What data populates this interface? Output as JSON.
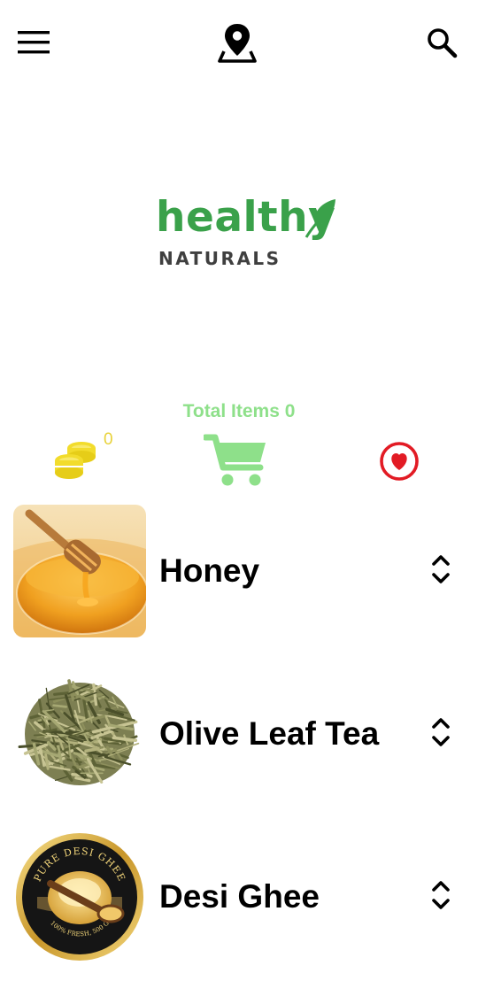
{
  "header": {
    "menu_icon": "hamburger-menu-icon",
    "location_icon": "map-pin-icon",
    "search_icon": "search-icon"
  },
  "logo": {
    "word": "healthy",
    "subtitle": "NATURALS",
    "brand_color": "#3aa14a",
    "subtitle_color": "#3f3f3f"
  },
  "summary": {
    "total_items_label": "Total Items 0",
    "coin_count": "0",
    "coins_icon": "coins-icon",
    "cart_icon": "shopping-cart-icon",
    "favorites_icon": "heart-icon",
    "accent_green": "#8ee08a",
    "coin_yellow": "#f2dc2c",
    "heart_red": "#e21b24"
  },
  "products": [
    {
      "name": "Honey",
      "image": "honey-image",
      "stepper_icon": "chevron-up-down-icon"
    },
    {
      "name": "Olive Leaf Tea",
      "image": "olive-leaf-tea-image",
      "stepper_icon": "chevron-up-down-icon"
    },
    {
      "name": "Desi Ghee",
      "image": "desi-ghee-image",
      "stepper_icon": "chevron-up-down-icon",
      "label_arc_top": "PURE DESI GHEE",
      "label_arc_bottom": "100% FRESH, 500 G"
    }
  ]
}
